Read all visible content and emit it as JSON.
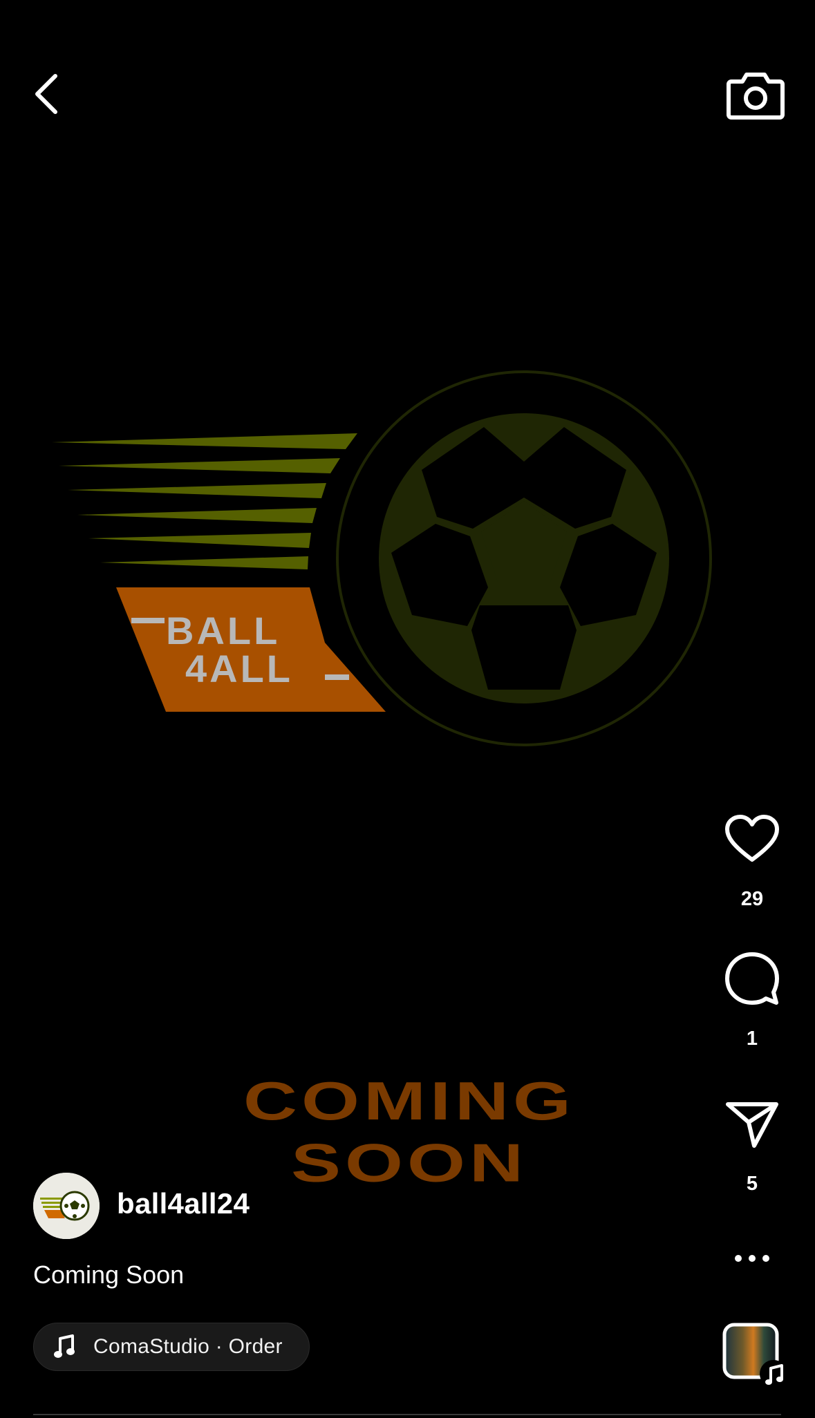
{
  "post": {
    "username": "ball4all24",
    "caption": "Coming Soon"
  },
  "media": {
    "logo_text_line1": "BALL",
    "logo_text_line2": "4ALL",
    "headline_line1": "COMING",
    "headline_line2": "SOON"
  },
  "actions": {
    "likes": "29",
    "comments": "1",
    "shares": "5"
  },
  "audio": {
    "label": "ComaStudio · Order"
  },
  "icons": {
    "back": "chevron-left-icon",
    "camera": "camera-icon",
    "like": "heart-icon",
    "comment": "comment-bubble-icon",
    "share": "paper-plane-icon",
    "more": "more-horizontal-icon",
    "music": "music-note-icon"
  },
  "colors": {
    "background": "#000000",
    "logo_orange": "#a85000",
    "logo_olive": "#556000",
    "ball_dark": "#1f2604",
    "headline_orange": "#7a3a00",
    "text": "#ffffff"
  }
}
